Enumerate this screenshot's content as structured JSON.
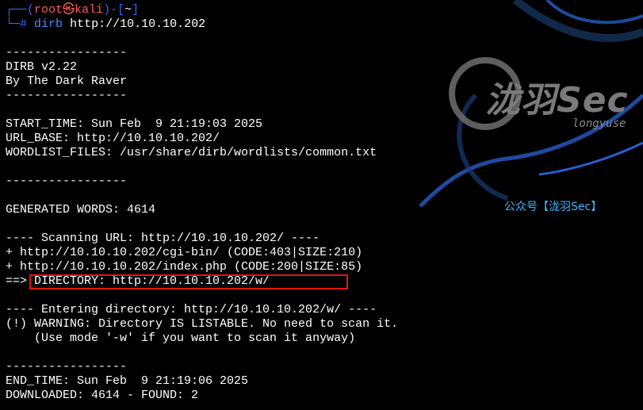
{
  "prompt": {
    "user": "root",
    "symbol": "㉿",
    "host": "kali",
    "dir": "~",
    "hash": "#",
    "command": "dirb",
    "argument": "http://10.10.10.202"
  },
  "output": [
    "",
    "-----------------",
    "DIRB v2.22",
    "By The Dark Raver",
    "-----------------",
    "",
    "START_TIME: Sun Feb  9 21:19:03 2025",
    "URL_BASE: http://10.10.10.202/",
    "WORDLIST_FILES: /usr/share/dirb/wordlists/common.txt",
    "",
    "-----------------",
    "",
    "GENERATED WORDS: 4614",
    "",
    "---- Scanning URL: http://10.10.10.202/ ----",
    "+ http://10.10.10.202/cgi-bin/ (CODE:403|SIZE:210)",
    "+ http://10.10.10.202/index.php (CODE:200|SIZE:85)",
    "==> DIRECTORY: http://10.10.10.202/w/",
    "",
    "---- Entering directory: http://10.10.10.202/w/ ----",
    "(!) WARNING: Directory IS LISTABLE. No need to scan it.",
    "    (Use mode '-w' if you want to scan it anyway)",
    "",
    "-----------------",
    "END_TIME: Sun Feb  9 21:19:06 2025",
    "DOWNLOADED: 4614 - FOUND: 2"
  ],
  "watermark": {
    "logo": "泷羽Sec",
    "subtitle": "longyuse",
    "public_account": "公众号【泷羽Sec】"
  },
  "colors": {
    "background": "#000000",
    "prompt_blue": "#2b6bff",
    "prompt_red": "#ff5a5a",
    "highlight_box": "#e01616",
    "watermark_blue": "#3fb6ff"
  }
}
